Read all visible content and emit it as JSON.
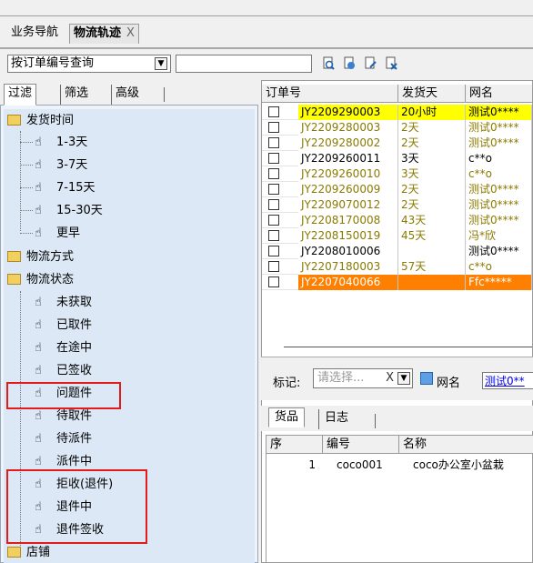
{
  "tabs": {
    "nav_label": "业务导航",
    "track_label": "物流轨迹",
    "close_label": "X"
  },
  "toolbar": {
    "query_type": "按订单编号查询",
    "query_value": ""
  },
  "left_tabs": {
    "filter": "过滤",
    "screen": "筛选",
    "advanced": "高级"
  },
  "tree": {
    "ship_time": {
      "label": "发货时间",
      "items": [
        "1-3天",
        "3-7天",
        "7-15天",
        "15-30天",
        "更早"
      ]
    },
    "logistics_method": {
      "label": "物流方式"
    },
    "logistics_status": {
      "label": "物流状态",
      "items": [
        "未获取",
        "已取件",
        "在途中",
        "已签收",
        "问题件",
        "待取件",
        "待派件",
        "派件中",
        "拒收(退件)",
        "退件中",
        "退件签收"
      ]
    },
    "shop": {
      "label": "店铺"
    }
  },
  "orders": {
    "headers": {
      "order_no": "订单号",
      "ship_days": "发货天",
      "net": "网名"
    },
    "rows": [
      {
        "order_no": "JY2209290003",
        "days": "20小时",
        "net": "测试0****",
        "style": "yellow"
      },
      {
        "order_no": "JY2209280003",
        "days": "2天",
        "net": "测试0****",
        "style": "olive"
      },
      {
        "order_no": "JY2209280002",
        "days": "2天",
        "net": "测试0****",
        "style": "olive"
      },
      {
        "order_no": "JY2209260011",
        "days": "3天",
        "net": "c**o",
        "style": "normal"
      },
      {
        "order_no": "JY2209260010",
        "days": "3天",
        "net": "c**o",
        "style": "olive"
      },
      {
        "order_no": "JY2209260009",
        "days": "2天",
        "net": "测试0****",
        "style": "olive"
      },
      {
        "order_no": "JY2209070012",
        "days": "2天",
        "net": "测试0****",
        "style": "olive"
      },
      {
        "order_no": "JY2208170008",
        "days": "43天",
        "net": "测试0****",
        "style": "olive"
      },
      {
        "order_no": "JY2208150019",
        "days": "45天",
        "net": "冯*欣",
        "style": "olive"
      },
      {
        "order_no": "JY2208010006",
        "days": "",
        "net": "测试0****",
        "style": "normal"
      },
      {
        "order_no": "JY2207180003",
        "days": "57天",
        "net": "c**o",
        "style": "olive"
      },
      {
        "order_no": "JY2207040066",
        "days": "",
        "net": "Ffc*****",
        "style": "orange"
      }
    ]
  },
  "mark": {
    "label": "标记:",
    "placeholder": "请选择...",
    "clear": "X",
    "net_label": "网名",
    "net_value": "测试0**"
  },
  "bottom_tabs": {
    "goods": "货品",
    "log": "日志"
  },
  "goods": {
    "headers": {
      "seq": "序",
      "code": "编号",
      "name": "名称"
    },
    "rows": [
      {
        "seq": "1",
        "code": "coco001",
        "name": "coco办公室小盆栽"
      }
    ]
  },
  "colors": {
    "highlight_red": "#e21b1b",
    "row_yellow": "#ffff00",
    "row_orange": "#ff8000",
    "text_olive": "#8a7a00"
  }
}
